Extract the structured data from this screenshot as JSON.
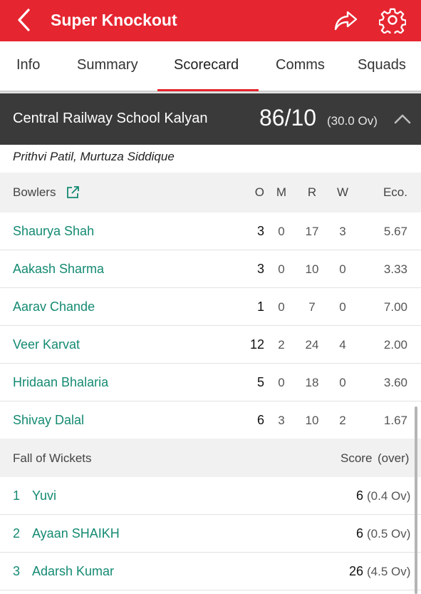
{
  "app": {
    "title": "Super Knockout",
    "icons": {
      "back": "back-arrow-icon",
      "share": "share-icon",
      "settings": "gear-icon"
    }
  },
  "tabs": [
    {
      "label": "Info",
      "active": false
    },
    {
      "label": "Summary",
      "active": false
    },
    {
      "label": "Scorecard",
      "active": true
    },
    {
      "label": "Comms",
      "active": false
    },
    {
      "label": "Squads",
      "active": false
    }
  ],
  "innings": {
    "team": "Central Railway School Kalyan",
    "score": "86/10",
    "overs": "(30.0 Ov)",
    "did_not_bat": "Prithvi Patil, Murtuza Siddique"
  },
  "bowling": {
    "header": {
      "label": "Bowlers",
      "o": "O",
      "m": "M",
      "r": "R",
      "w": "W",
      "eco": "Eco."
    },
    "rows": [
      {
        "name": "Shaurya Shah",
        "o": "3",
        "m": "0",
        "r": "17",
        "w": "3",
        "eco": "5.67"
      },
      {
        "name": "Aakash Sharma",
        "o": "3",
        "m": "0",
        "r": "10",
        "w": "0",
        "eco": "3.33"
      },
      {
        "name": "Aarav Chande",
        "o": "1",
        "m": "0",
        "r": "7",
        "w": "0",
        "eco": "7.00"
      },
      {
        "name": "Veer Karvat",
        "o": "12",
        "m": "2",
        "r": "24",
        "w": "4",
        "eco": "2.00"
      },
      {
        "name": "Hridaan Bhalaria",
        "o": "5",
        "m": "0",
        "r": "18",
        "w": "0",
        "eco": "3.60"
      },
      {
        "name": "Shivay Dalal",
        "o": "6",
        "m": "3",
        "r": "10",
        "w": "2",
        "eco": "1.67"
      }
    ]
  },
  "fall_of_wickets": {
    "header": {
      "label": "Fall of Wickets",
      "score_label": "Score",
      "over_label": "(over)"
    },
    "rows": [
      {
        "num": "1",
        "name": "Yuvi",
        "score": "6",
        "over": "(0.4 Ov)"
      },
      {
        "num": "2",
        "name": "Ayaan SHAIKH",
        "score": "6",
        "over": "(0.5 Ov)"
      },
      {
        "num": "3",
        "name": "Adarsh Kumar",
        "score": "26",
        "over": "(4.5 Ov)"
      }
    ]
  },
  "colors": {
    "brand": "#e52530",
    "link": "#148a72",
    "header_bg": "#3a3a3a",
    "section_bg": "#f1f1f1"
  }
}
